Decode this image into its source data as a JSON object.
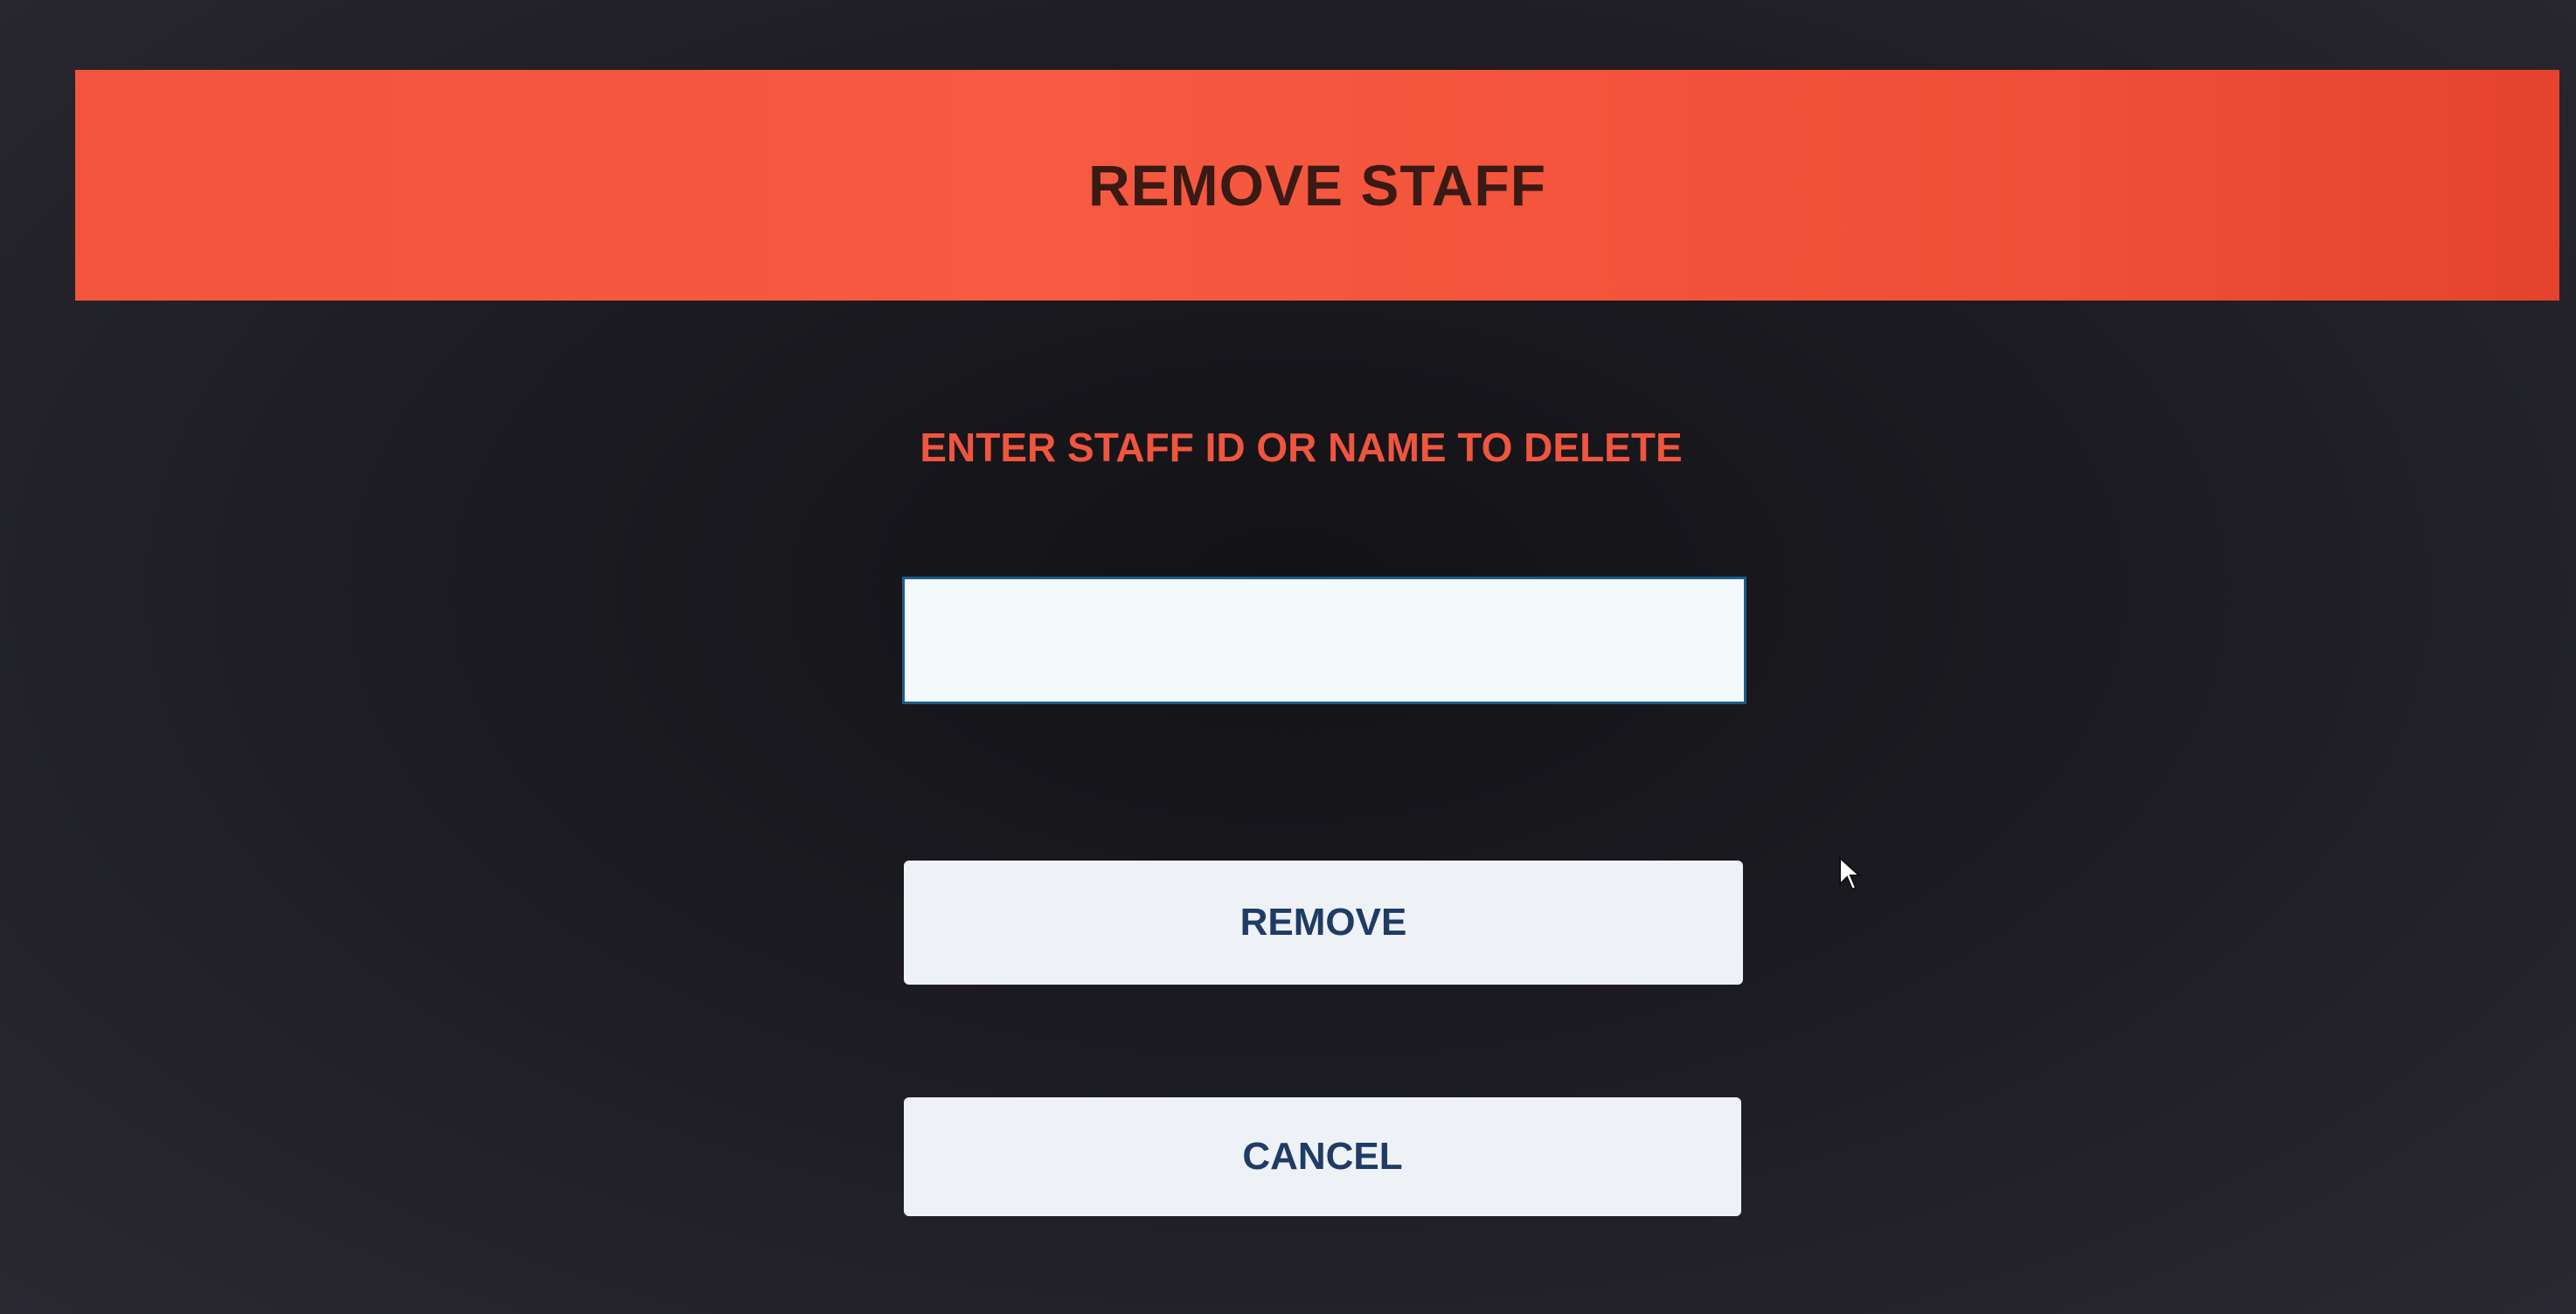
{
  "header": {
    "title": "REMOVE STAFF"
  },
  "form": {
    "prompt": "ENTER STAFF ID OR NAME TO DELETE",
    "input_value": ""
  },
  "buttons": {
    "remove_label": "REMOVE",
    "cancel_label": "CANCEL"
  },
  "colors": {
    "accent": "#f65a40",
    "background": "#1c1b21",
    "button_bg": "#eef2f6",
    "button_text": "#1f3b66"
  }
}
